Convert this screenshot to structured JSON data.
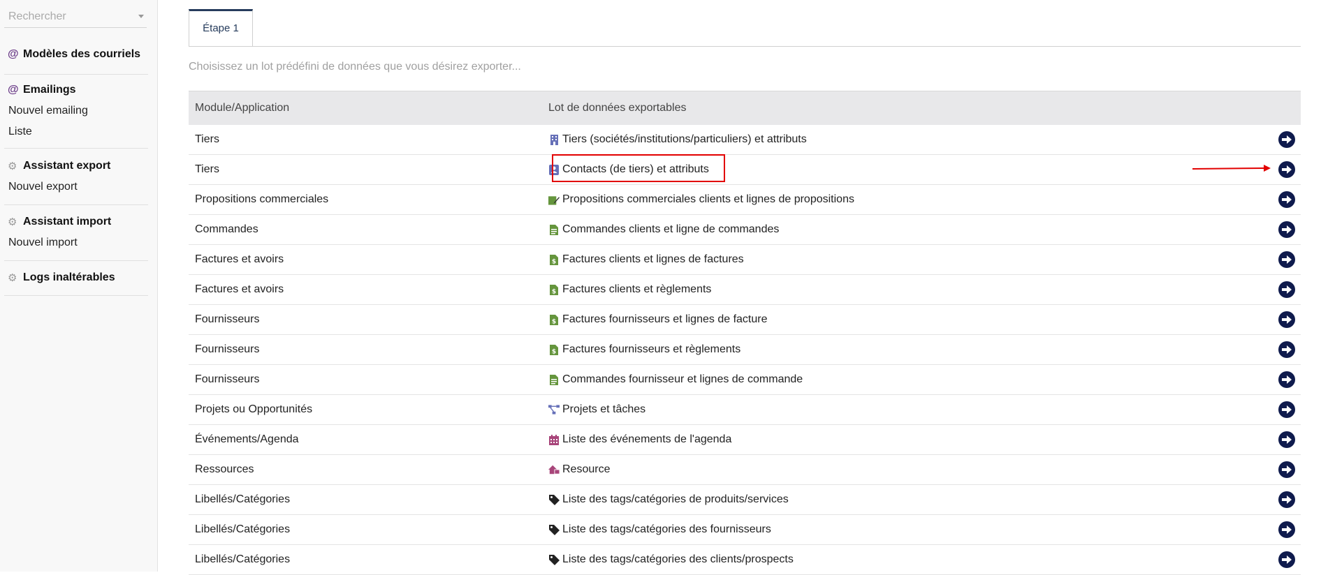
{
  "sidebar": {
    "search_placeholder": "Rechercher",
    "blocks": [
      {
        "title": "Modèles des courriels",
        "icon": "at-icon",
        "items": []
      },
      {
        "title": "Emailings",
        "icon": "at-icon",
        "items": [
          "Nouvel emailing",
          "Liste"
        ]
      },
      {
        "title": "Assistant export",
        "icon": "gears-icon",
        "items": [
          "Nouvel export"
        ]
      },
      {
        "title": "Assistant import",
        "icon": "gears-icon",
        "items": [
          "Nouvel import"
        ]
      },
      {
        "title": "Logs inaltérables",
        "icon": "gears-icon",
        "items": []
      }
    ]
  },
  "main": {
    "tab_label": "Étape 1",
    "hint": "Choisissez un lot prédéfini de données que vous désirez exporter...",
    "headers": {
      "module": "Module/Application",
      "lot": "Lot de données exportables"
    },
    "rows": [
      {
        "module": "Tiers",
        "lot": "Tiers (sociétés/institutions/particuliers) et attributs",
        "icon": "building-icon",
        "color": "#6670b8"
      },
      {
        "module": "Tiers",
        "lot": "Contacts (de tiers) et attributs",
        "icon": "contact-card-icon",
        "color": "#6670b8"
      },
      {
        "module": "Propositions commerciales",
        "lot": "Propositions commerciales clients et lignes de propositions",
        "icon": "proposal-edit-icon",
        "color": "#65953d"
      },
      {
        "module": "Commandes",
        "lot": "Commandes clients et ligne de commandes",
        "icon": "document-icon",
        "color": "#65953d"
      },
      {
        "module": "Factures et avoirs",
        "lot": "Factures clients et lignes de factures",
        "icon": "invoice-icon",
        "color": "#65953d"
      },
      {
        "module": "Factures et avoirs",
        "lot": "Factures clients et règlements",
        "icon": "invoice-icon",
        "color": "#65953d"
      },
      {
        "module": "Fournisseurs",
        "lot": "Factures fournisseurs et lignes de facture",
        "icon": "invoice-icon",
        "color": "#65953d"
      },
      {
        "module": "Fournisseurs",
        "lot": "Factures fournisseurs et règlements",
        "icon": "invoice-icon",
        "color": "#65953d"
      },
      {
        "module": "Fournisseurs",
        "lot": "Commandes fournisseur et lignes de commande",
        "icon": "document-icon",
        "color": "#65953d"
      },
      {
        "module": "Projets ou Opportunités",
        "lot": "Projets et tâches",
        "icon": "project-tree-icon",
        "color": "#6670b8"
      },
      {
        "module": "Événements/Agenda",
        "lot": "Liste des événements de l'agenda",
        "icon": "calendar-icon",
        "color": "#a8457a"
      },
      {
        "module": "Ressources",
        "lot": "Resource",
        "icon": "resource-icon",
        "color": "#a8457a"
      },
      {
        "module": "Libellés/Catégories",
        "lot": "Liste des tags/catégories de produits/services",
        "icon": "tag-icon",
        "color": "#222222"
      },
      {
        "module": "Libellés/Catégories",
        "lot": "Liste des tags/catégories des fournisseurs",
        "icon": "tag-icon",
        "color": "#222222"
      },
      {
        "module": "Libellés/Catégories",
        "lot": "Liste des tags/catégories des clients/prospects",
        "icon": "tag-icon",
        "color": "#222222"
      }
    ]
  },
  "colors": {
    "accent": "#0f1b4d",
    "highlight": "#e20000"
  }
}
